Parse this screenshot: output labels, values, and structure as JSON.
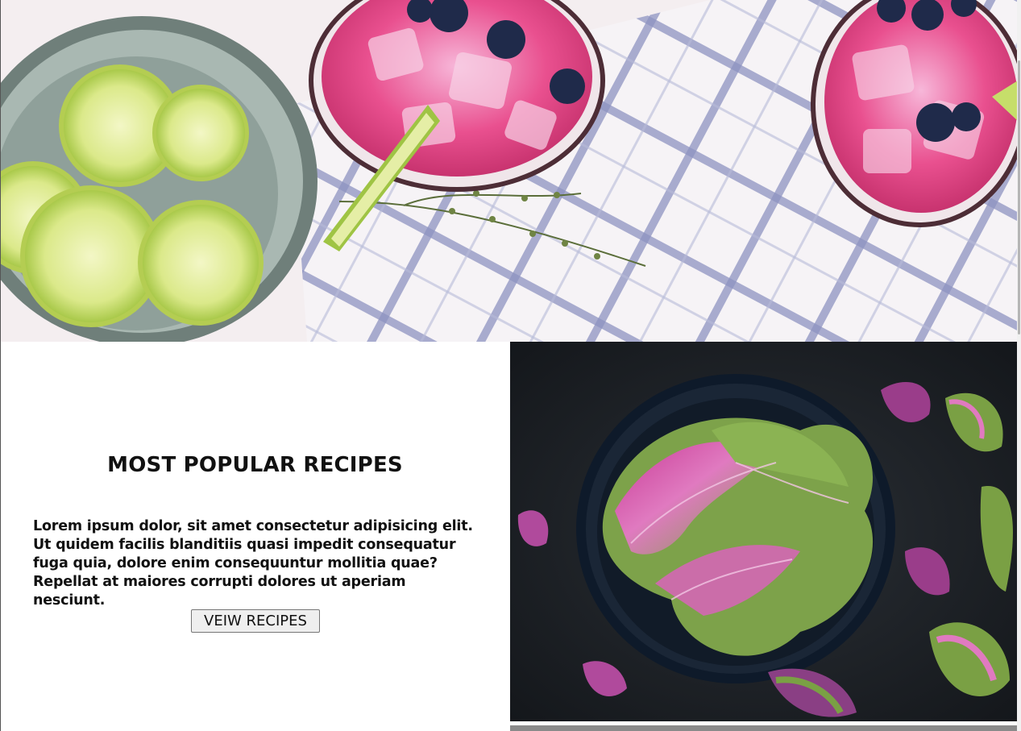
{
  "section": {
    "title": "MOST POPULAR RECIPES",
    "body": "Lorem ipsum dolor, sit amet consectetur adipisicing elit. Ut quidem facilis blanditiis quasi impedit consequatur fuga quia, dolore enim consequuntur mollitia quae? Repellat at maiores corrupti dolores ut aperiam nesciunt.",
    "button_label": "VEIW RECIPES"
  }
}
